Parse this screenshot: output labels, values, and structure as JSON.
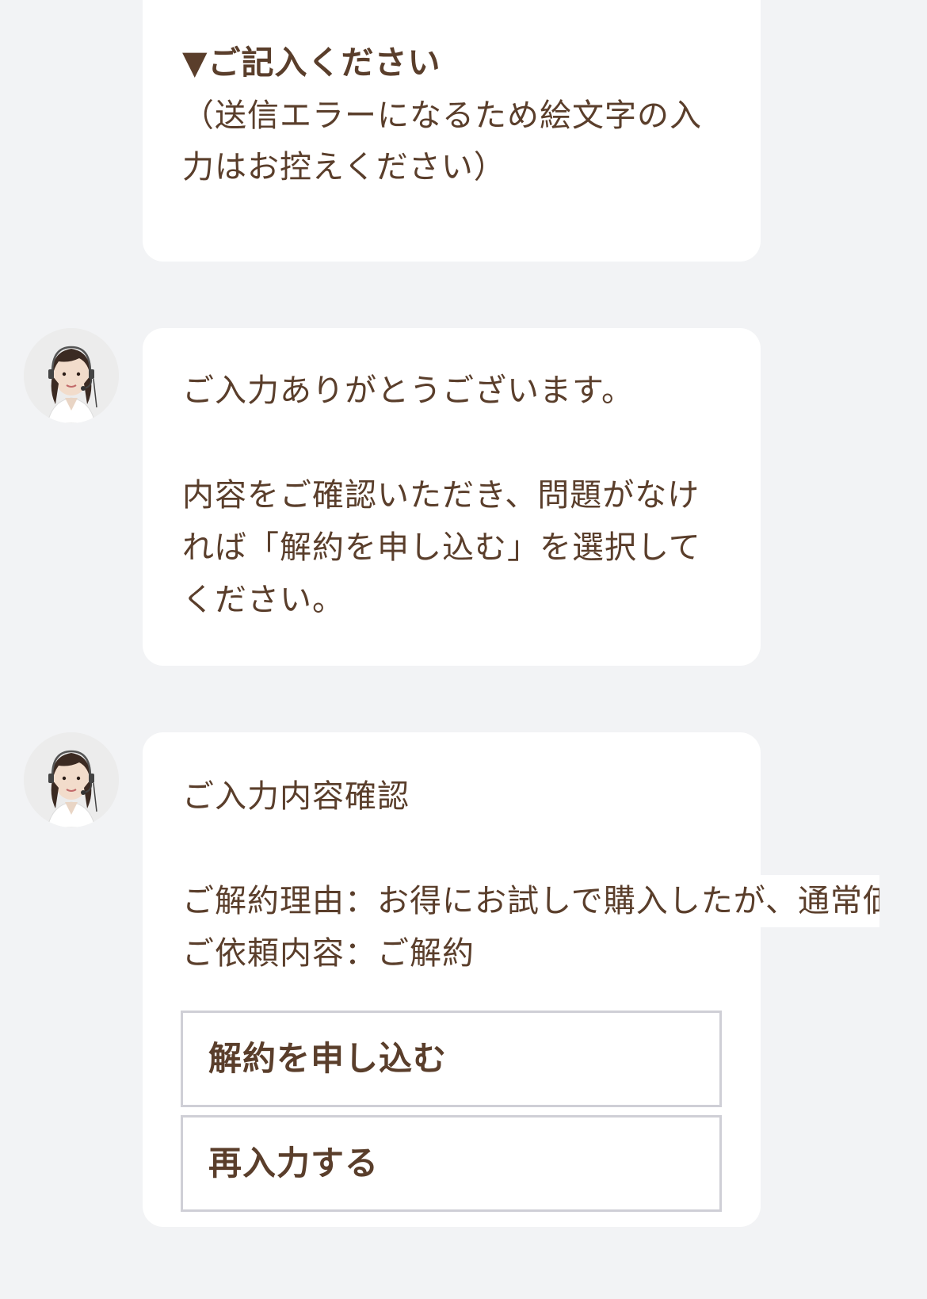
{
  "bubble_note": {
    "heading": "▼ご記入ください",
    "line1": "（送信エラーになるため絵文字の入",
    "line2": "力はお控えください）"
  },
  "bubble_thanks": {
    "line1": "ご入力ありがとうございます。",
    "line2": "内容をご確認いただき、問題がなけ",
    "line3": "れば「解約を申し込む」を選択して",
    "line4": "ください。"
  },
  "bubble_confirm": {
    "title": "ご入力内容確認",
    "reason": "ご解約理由：お得にお試しで購入したが、通常価",
    "request": "ご依頼内容：ご解約",
    "apply_button": "解約を申し込む",
    "reenter_button": "再入力する"
  },
  "colors": {
    "background": "#f2f3f5",
    "bubble": "#ffffff",
    "text": "#5a3e2b",
    "button_border": "#cfcfd6"
  },
  "icons": {
    "avatar": "operator-avatar"
  }
}
